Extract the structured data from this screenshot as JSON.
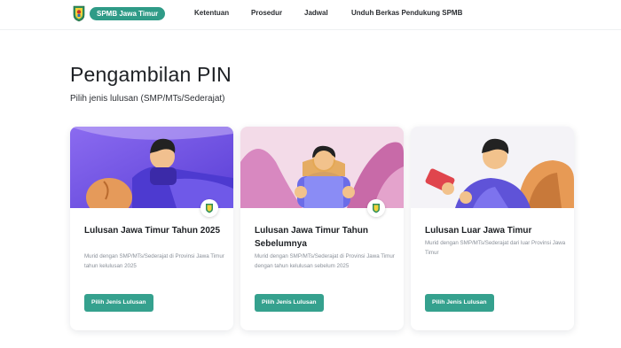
{
  "navbar": {
    "brand": "SPMB Jawa Timur",
    "links": [
      "Ketentuan",
      "Prosedur",
      "Jadwal",
      "Unduh Berkas Pendukung SPMB"
    ]
  },
  "header": {
    "title": "Pengambilan PIN",
    "subtitle": "Pilih jenis lulusan (SMP/MTs/Sederajat)"
  },
  "cards": [
    {
      "title": "Lulusan Jawa Timur Tahun 2025",
      "description": "Murid dengan SMP/MTs/Sederajat di Provinsi Jawa Timur tahun kelulusan 2025",
      "button": "Pilih Jenis Lulusan"
    },
    {
      "title": "Lulusan Jawa Timur Tahun Sebelumnya",
      "description": "Murid dengan SMP/MTs/Sederajat di Provinsi Jawa Timur dengan tahun kelulusan sebelum 2025",
      "button": "Pilih Jenis Lulusan"
    },
    {
      "title": "Lulusan Luar Jawa Timur",
      "description": "Murid dengan SMP/MTs/Sederajat dari luar Provinsi Jawa Timur",
      "button": "Pilih Jenis Lulusan"
    }
  ],
  "colors": {
    "brand": "#2f9b87",
    "button": "#35a18e",
    "illustration_bg_1": "#7b5be8",
    "illustration_bg_2": "#f1d9e6",
    "illustration_bg_3": "#f3f2f5"
  },
  "icons": [
    "jatim-logo-icon",
    "jatim-emblem-icon"
  ]
}
